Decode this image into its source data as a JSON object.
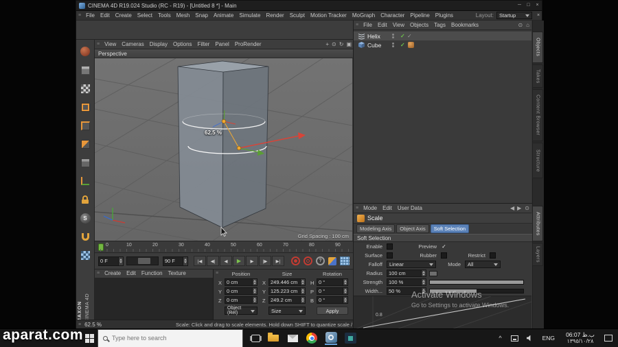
{
  "glyphs": {
    "minimize": "─",
    "maximize": "□",
    "close": "×",
    "check": "✓",
    "grip": "≡",
    "undo": "↶",
    "redo": "↷",
    "goto_start": "|◀",
    "prev_key": "◀|",
    "prev_frame": "◀",
    "play": "▶",
    "next_frame": "▶",
    "next_key": "|▶",
    "goto_end": "▶|",
    "record_q": "?",
    "pan": "+",
    "zoom": "⊙",
    "orbit": "↻",
    "toggle": "▣",
    "coord": "⊕",
    "home": "⌂",
    "target": "⊙",
    "back": "◀",
    "fwd": "▶",
    "chevron": "^",
    "x": "X",
    "y": "Y",
    "z": "Z",
    "s": "S"
  },
  "titlebar": {
    "title": "CINEMA 4D R19.024 Studio (RC - R19) - [Untitled 8 *] - Main"
  },
  "menubar": {
    "items": [
      "File",
      "Edit",
      "Create",
      "Select",
      "Tools",
      "Mesh",
      "Snap",
      "Animate",
      "Simulate",
      "Render",
      "Sculpt",
      "Motion Tracker",
      "MoGraph",
      "Character",
      "Pipeline",
      "Plugins"
    ],
    "layout_label": "Layout:",
    "layout_value": "Startup"
  },
  "viewport": {
    "menus": [
      "View",
      "Cameras",
      "Display",
      "Options",
      "Filter",
      "Panel",
      "ProRender"
    ],
    "camera": "Perspective",
    "scale_label": "62.5 %",
    "grid_spacing": "Grid Spacing : 100 cm"
  },
  "timeline": {
    "ticks": [
      "0",
      "10",
      "20",
      "30",
      "40",
      "50",
      "60",
      "70",
      "80",
      "90"
    ],
    "range_start": "0 F",
    "range_end": "90 F"
  },
  "materials": {
    "menus": [
      "Create",
      "Edit",
      "Function",
      "Texture"
    ]
  },
  "coordinates": {
    "headers": [
      "Position",
      "Size",
      "Rotation"
    ],
    "pos_labels": [
      "X",
      "Y",
      "Z"
    ],
    "pos_values": [
      "0 cm",
      "0 cm",
      "0 cm"
    ],
    "size_labels": [
      "X",
      "Y",
      "Z"
    ],
    "size_values": [
      "249.446 cm",
      "125.223 cm",
      "249.2 cm"
    ],
    "rot_labels": [
      "H",
      "P",
      "B"
    ],
    "rot_values": [
      "0 °",
      "0 °",
      "0 °"
    ],
    "object_mode": "Object (Rel)",
    "size_mode": "Size",
    "apply": "Apply"
  },
  "status": {
    "percent": "62.5 %",
    "message": "Scale: Click and drag to scale elements. Hold down SHIFT to quantize scale / add to the selectio"
  },
  "object_manager": {
    "menus": [
      "File",
      "Edit",
      "View",
      "Objects",
      "Tags",
      "Bookmarks"
    ],
    "objects": [
      {
        "name": "Helix"
      },
      {
        "name": "Cube"
      }
    ],
    "side_tabs": [
      "Objects",
      "Takes",
      "Content Browser",
      "Structure"
    ]
  },
  "attributes": {
    "menus": [
      "Mode",
      "Edit",
      "User Data"
    ],
    "tool": "Scale",
    "tabs": [
      "Modeling Axis",
      "Object Axis",
      "Soft Selection"
    ],
    "section": "Soft Selection",
    "labels": {
      "enable": "Enable",
      "preview": "Preview",
      "surface": "Surface",
      "rubber": "Rubber",
      "restrict": "Restrict",
      "falloff": "Falloff",
      "mode": "Mode",
      "radius": "Radius",
      "strength": "Strength",
      "width": "Width..."
    },
    "values": {
      "falloff": "Linear",
      "mode": "All",
      "radius": "100 cm",
      "strength": "100 %",
      "width": "50 %"
    },
    "graph_tick": "0.8",
    "side_tabs": [
      "Attributes",
      "Layers"
    ]
  },
  "activate": {
    "line1": "Activate Windows",
    "line2": "Go to Settings to activate Windows."
  },
  "branding": {
    "maxon": "MAXON",
    "cinema": "CINEMA 4D",
    "watermark": "aparat.com"
  },
  "taskbar": {
    "search_placeholder": "Type here to search",
    "language": "ENG",
    "time": "06:07 ب.ظ",
    "date": "١٣٩٥/١٠/٢٨"
  }
}
